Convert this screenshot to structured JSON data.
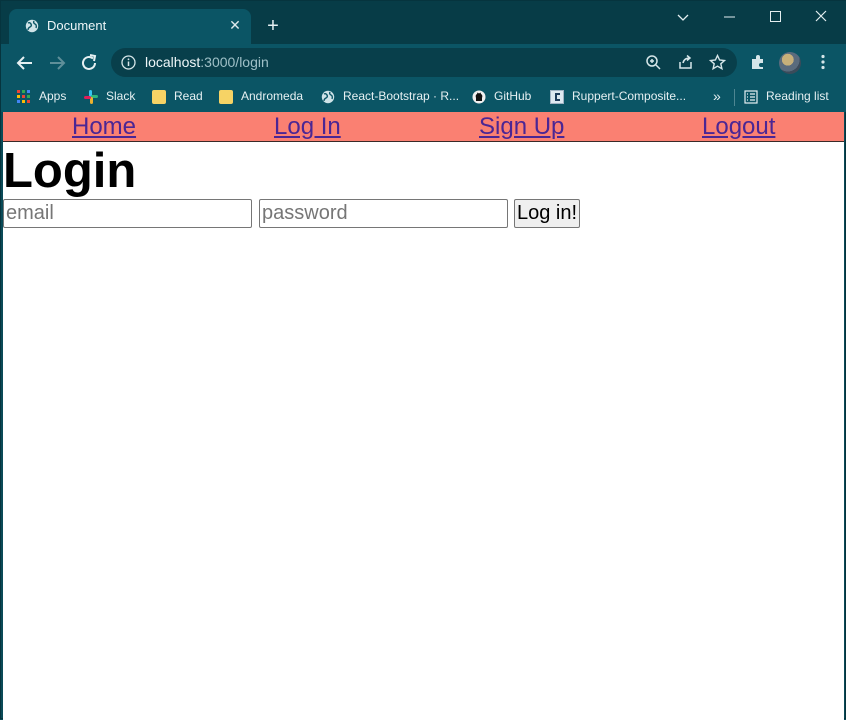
{
  "browser": {
    "tab": {
      "title": "Document",
      "favicon": "globe-icon"
    },
    "window_controls": [
      "chevron-down-icon",
      "minimize-icon",
      "maximize-icon",
      "close-icon"
    ],
    "url": {
      "host": "localhost",
      "rest": ":3000/login"
    },
    "bookmarks": [
      {
        "label": "Apps",
        "icon": "apps-grid-icon"
      },
      {
        "label": "Slack",
        "icon": "slack-icon"
      },
      {
        "label": "Read",
        "icon": "folder-icon"
      },
      {
        "label": "Andromeda",
        "icon": "folder-icon"
      },
      {
        "label": "React-Bootstrap · R...",
        "icon": "globe-icon"
      },
      {
        "label": "GitHub",
        "icon": "github-icon"
      },
      {
        "label": "Ruppert-Composite...",
        "icon": "site-icon"
      }
    ],
    "overflow_label": "»",
    "reading_list": "Reading list"
  },
  "page": {
    "nav": [
      "Home",
      "Log In",
      "Sign Up",
      "Logout"
    ],
    "title": "Login",
    "form": {
      "email_placeholder": "email",
      "password_placeholder": "password",
      "submit_label": "Log in!"
    }
  },
  "colors": {
    "navbar_bg": "#fa8072",
    "link": "#4b2694",
    "chrome_dark": "#073c47",
    "chrome": "#0b5565"
  }
}
